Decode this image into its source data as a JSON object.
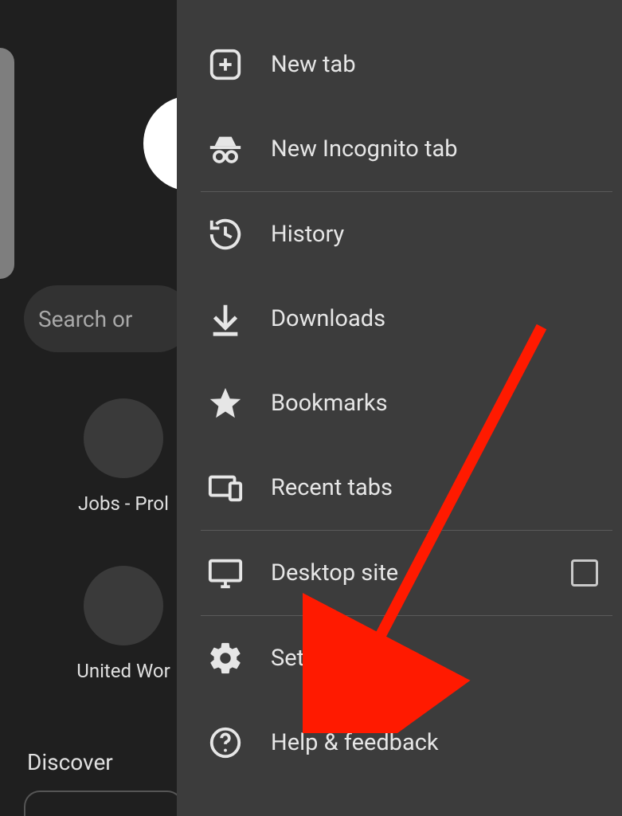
{
  "background": {
    "search_placeholder": "Search or ",
    "shortcut1": "Jobs - Prol",
    "shortcut2": "United Wor",
    "discover": "Discover"
  },
  "menu": {
    "new_tab": "New tab",
    "new_incognito": "New Incognito tab",
    "history": "History",
    "downloads": "Downloads",
    "bookmarks": "Bookmarks",
    "recent_tabs": "Recent tabs",
    "desktop_site": "Desktop site",
    "settings": "Settings",
    "help_feedback": "Help & feedback"
  },
  "annotation": {
    "target": "settings"
  }
}
